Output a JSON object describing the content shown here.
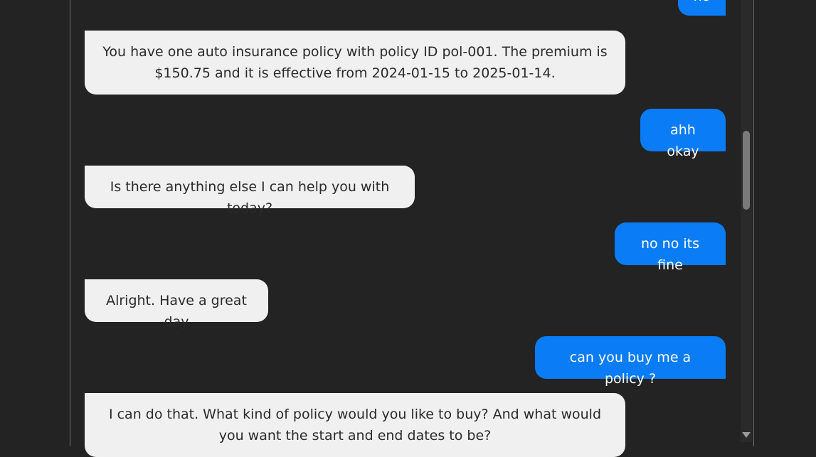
{
  "chat": {
    "messages": [
      {
        "role": "user",
        "text": "no"
      },
      {
        "role": "bot",
        "text": "You have one auto insurance policy with policy ID pol-001. The premium is $150.75 and it is effective from 2024-01-15 to 2025-01-14."
      },
      {
        "role": "user",
        "text": "ahh okay"
      },
      {
        "role": "bot",
        "text": "Is there anything else I can help you with today?"
      },
      {
        "role": "user",
        "text": "no no its fine"
      },
      {
        "role": "bot",
        "text": "Alright. Have a great day"
      },
      {
        "role": "user",
        "text": "can you buy me a policy ?"
      },
      {
        "role": "bot",
        "text": "I can do that. What kind of policy would you like to buy? And what would you want the start and end dates to be?"
      }
    ]
  },
  "colors": {
    "background": "#232323",
    "bot_bubble": "#f0f0f0",
    "user_bubble": "#0a7cf5"
  }
}
